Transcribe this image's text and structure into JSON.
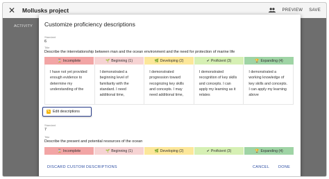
{
  "app": {
    "close_icon": "close-icon",
    "title": "Mollusks project",
    "people_icon": "people-icon",
    "preview_label": "PREVIEW",
    "save_label": "SAVE",
    "backdrop_tab": "ACTIVITY"
  },
  "dialog": {
    "title": "Customize proficiency descriptions",
    "discard_label": "DISCARD CUSTOM DESCRIPTIONS",
    "cancel_label": "CANCEL",
    "done_label": "DONE"
  },
  "standards": [
    {
      "standard_label": "Standard",
      "standard_value": "6",
      "title_label": "Title",
      "title_value": "Describe the interrelationship between man and the ocean environment and the need for protection of marine life"
    },
    {
      "standard_label": "Standard",
      "standard_value": "7",
      "title_label": "Title",
      "title_value": "Describe the present and potential resources of the ocean"
    }
  ],
  "levels": [
    {
      "label": "Incomplete",
      "icon": "hourglass-icon",
      "glyph": "⌛",
      "color": "#f2a5a5"
    },
    {
      "label": "Beginning (1)",
      "icon": "seedling-icon",
      "glyph": "🌱",
      "color": "#f6d3d3"
    },
    {
      "label": "Developing (2)",
      "icon": "sprout-icon",
      "glyph": "🌿",
      "color": "#fce79a"
    },
    {
      "label": "Proficient (3)",
      "icon": "check-icon",
      "glyph": "✔",
      "color": "#d6f0b4"
    },
    {
      "label": "Expanding (4)",
      "icon": "trophy-icon",
      "glyph": "🏆",
      "color": "#9fd4a5"
    }
  ],
  "descriptions": [
    "I have not yet provided enough evidence to determine my understanding of the",
    "I demonstrated a beginning level of familiarity with the standard. I need additional time,",
    "I demonstrated progression toward recognizing key skills and concepts. I may need additional time,",
    "I demonstrated recognition of key skills and concepts. I can apply my learning as it relates",
    "I demonstrated a working knowledge of key skills and concepts. I can apply my learning above"
  ],
  "edit_button": {
    "label": "Edit descriptions",
    "icon": "pencil-icon"
  }
}
